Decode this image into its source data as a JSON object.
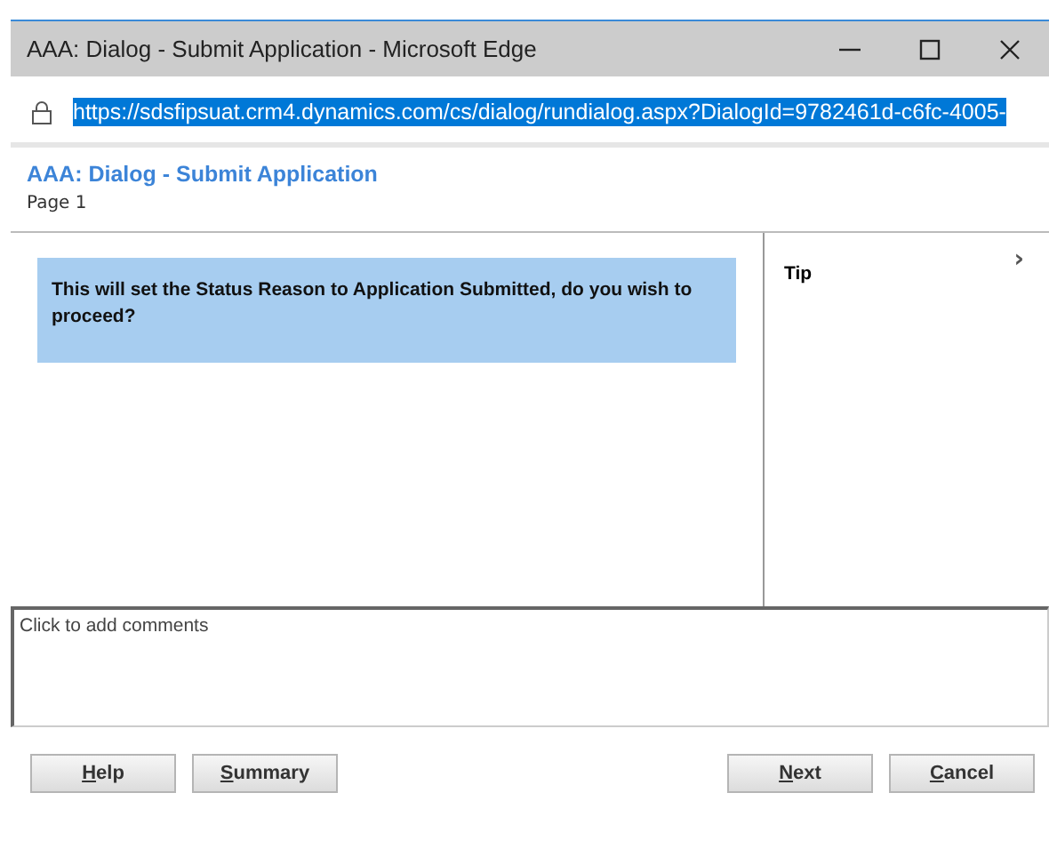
{
  "window": {
    "title": "AAA: Dialog - Submit Application - Microsoft Edge"
  },
  "address_bar": {
    "url": "https://sdsfipsuat.crm4.dynamics.com/cs/dialog/rundialog.aspx?DialogId=9782461d-c6fc-4005-",
    "selected": true
  },
  "dialog": {
    "title": "AAA: Dialog - Submit Application",
    "page": "Page 1"
  },
  "message": "This will set the Status Reason to Application Submitted, do you wish to proceed?",
  "tip": {
    "label": "Tip",
    "expander": "›"
  },
  "comments": {
    "placeholder": "Click to add comments"
  },
  "left_buttons": [
    "Help",
    "Summary"
  ],
  "right_buttons": [
    "Next",
    "Cancel"
  ]
}
